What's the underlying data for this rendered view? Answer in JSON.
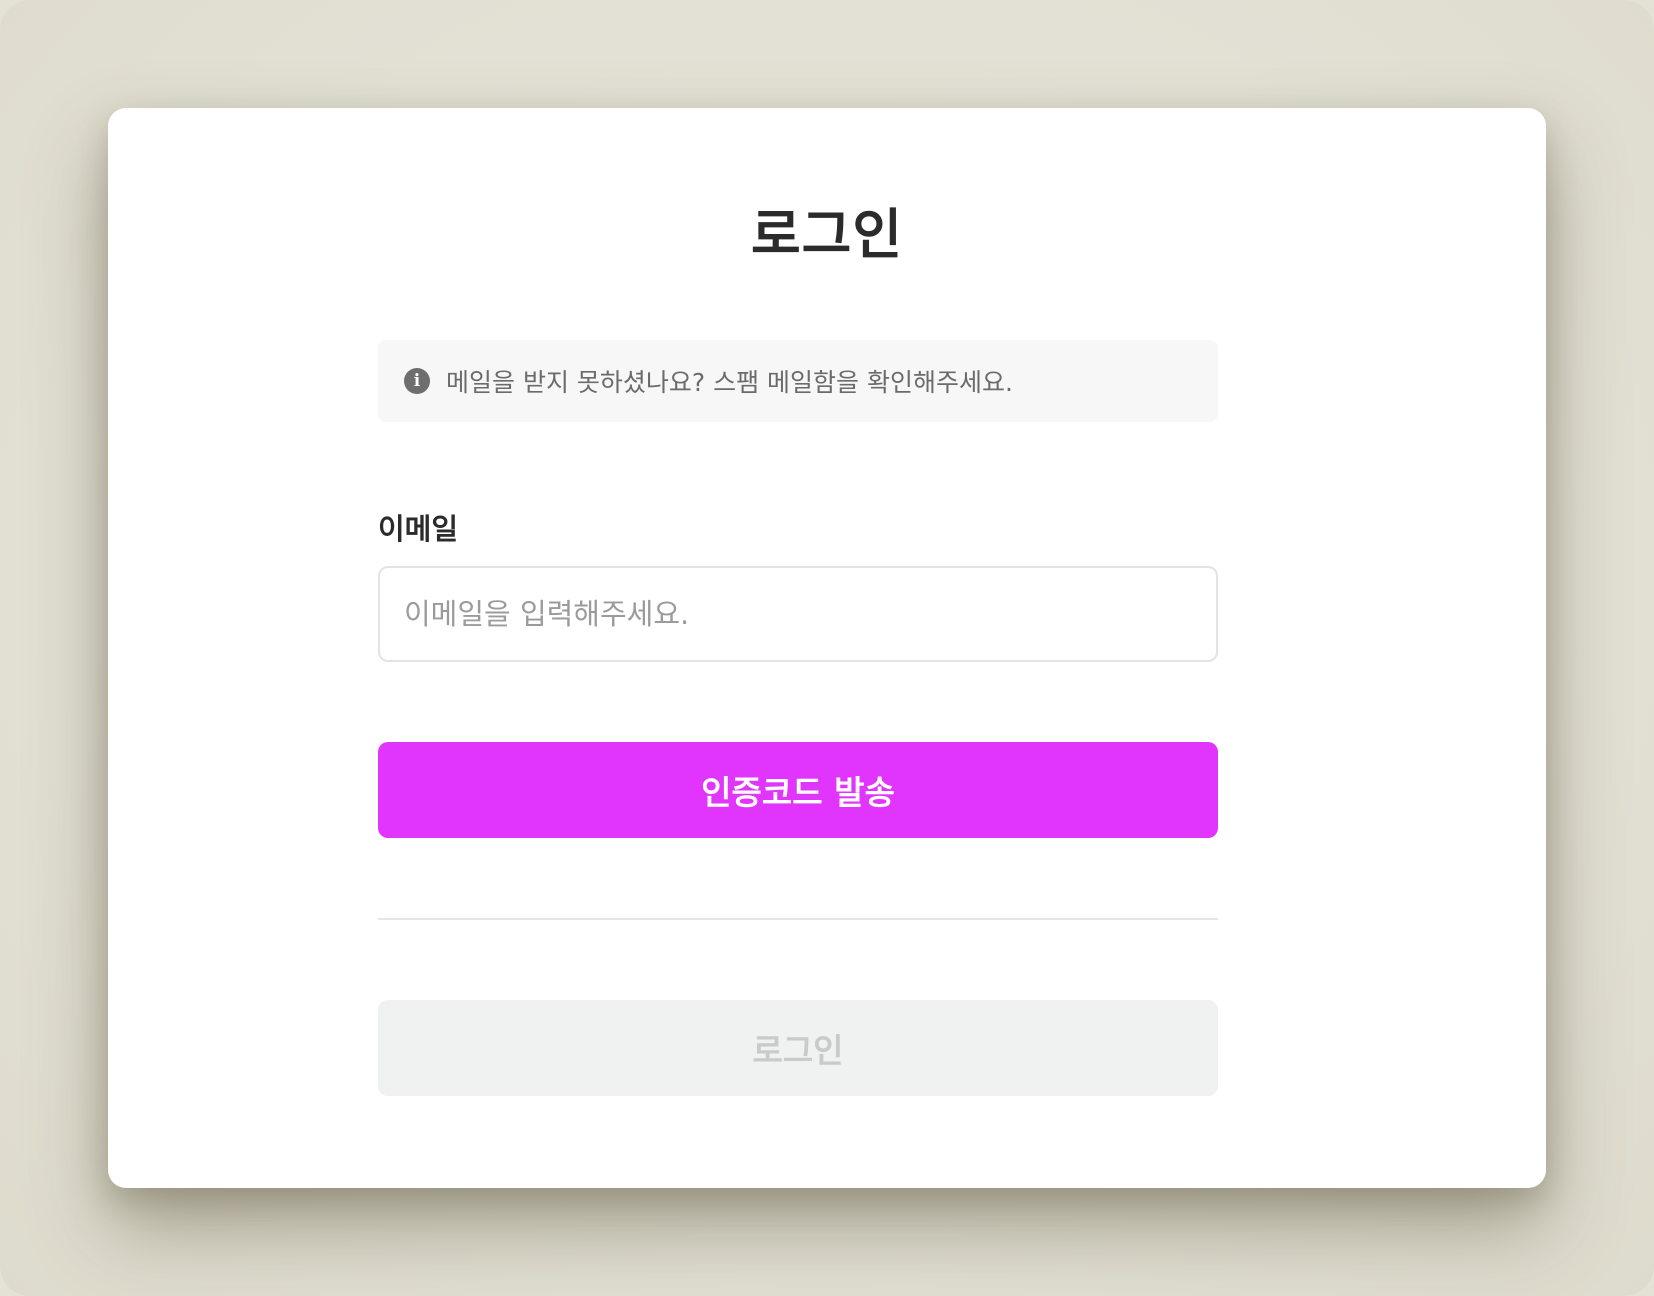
{
  "header": {
    "title": "로그인"
  },
  "notice": {
    "icon": "info-icon",
    "icon_glyph": "i",
    "text": "메일을 받지 못하셨나요? 스팸 메일함을 확인해주세요."
  },
  "form": {
    "email_label": "이메일",
    "email_value": "",
    "email_placeholder": "이메일을 입력해주세요.",
    "send_code_label": "인증코드 발송",
    "login_label": "로그인"
  },
  "colors": {
    "accent": "#e135fd",
    "disabled_bg": "#f0f1f1",
    "disabled_text": "#c9cbcb",
    "backdrop": "#e4e2d7"
  }
}
